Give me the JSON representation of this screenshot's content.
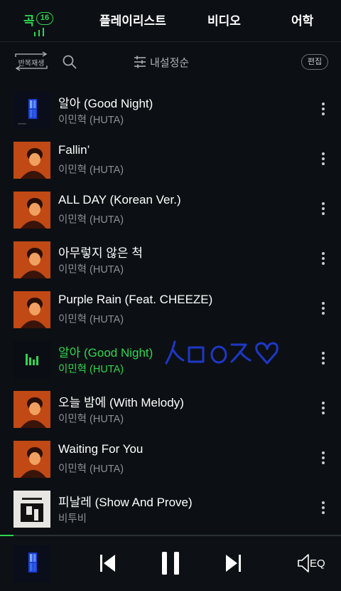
{
  "tabs": [
    {
      "label": "곡",
      "count": "16"
    },
    {
      "label": "플레이리스트"
    },
    {
      "label": "비디오"
    },
    {
      "label": "어학"
    }
  ],
  "toolbar": {
    "repeat_label": "반복재생",
    "sort_label": "내설정순",
    "edit_label": "편집"
  },
  "songs": [
    {
      "title": "알아 (Good Night)",
      "artist": "이민혁 (HUTA)",
      "art": "night-window"
    },
    {
      "title": "Fallin’",
      "artist": "이민혁 (HUTA)",
      "art": "orange-portrait"
    },
    {
      "title": "ALL DAY (Korean Ver.)",
      "artist": "이민혁 (HUTA)",
      "art": "orange-portrait"
    },
    {
      "title": "아무렇지 않은 척",
      "artist": "이민혁 (HUTA)",
      "art": "orange-portrait"
    },
    {
      "title": "Purple Rain (Feat. CHEEZE)",
      "artist": "이민혁 (HUTA)",
      "art": "orange-portrait"
    },
    {
      "title": "알아 (Good Night)",
      "artist": "이민혁 (HUTA)",
      "art": "now-playing-eq",
      "playing": true
    },
    {
      "title": "오늘 밤에 (With Melody)",
      "artist": "이민혁 (HUTA)",
      "art": "orange-portrait"
    },
    {
      "title": "Waiting For You",
      "artist": "이민혁 (HUTA)",
      "art": "orange-portrait"
    },
    {
      "title": "피날레 (Show And Prove)",
      "artist": "비투비",
      "art": "outside-cover"
    }
  ],
  "handwriting": "ㅅㅁㅇㅈ♡",
  "player": {
    "progress": 0.04,
    "eq_label": "EQ"
  },
  "colors": {
    "accent": "#2ed64f",
    "background": "#0c1014",
    "handwriting": "#1e37c8"
  },
  "icons": [
    "equalizer-bars-icon",
    "repeat-icon",
    "search-icon",
    "sliders-icon",
    "more-vert-icon",
    "previous-icon",
    "pause-icon",
    "next-icon",
    "speaker-eq-icon",
    "heart-icon"
  ]
}
